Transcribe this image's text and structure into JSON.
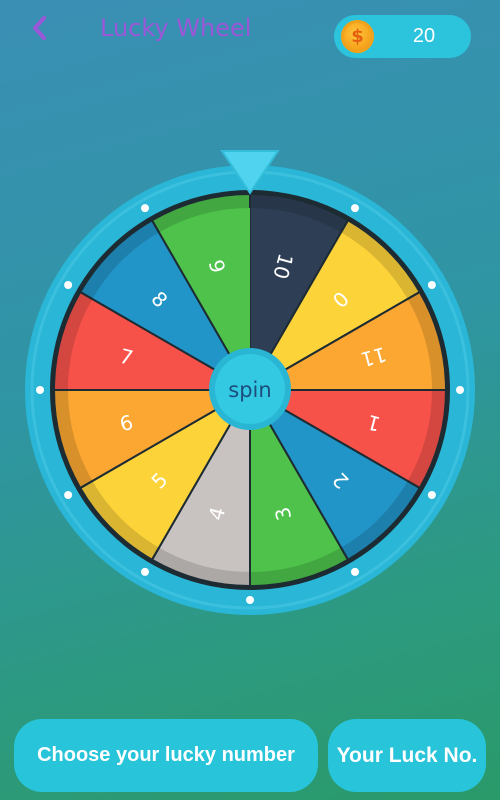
{
  "header": {
    "title": "Lucky Wheel",
    "back_icon": "chevron-left-icon",
    "coins": {
      "icon": "dollar-coin-icon",
      "symbol": "$",
      "count": "20"
    }
  },
  "wheel": {
    "pointer_icon": "triangle-pointer-icon",
    "spin_label": "spin",
    "segments": [
      {
        "label": "10",
        "color": "#2e3f55"
      },
      {
        "label": "0",
        "color": "#fdd33a"
      },
      {
        "label": "11",
        "color": "#fba732"
      },
      {
        "label": "1",
        "color": "#f7524a"
      },
      {
        "label": "2",
        "color": "#2295c8"
      },
      {
        "label": "3",
        "color": "#4ec24b"
      },
      {
        "label": "4",
        "color": "#c8c3c1"
      },
      {
        "label": "5",
        "color": "#fdd33a"
      },
      {
        "label": "6",
        "color": "#fba732"
      },
      {
        "label": "7",
        "color": "#f7524a"
      },
      {
        "label": "8",
        "color": "#2295c8"
      },
      {
        "label": "9",
        "color": "#4ec24b"
      }
    ]
  },
  "buttons": {
    "choose_label": "Choose your lucky number",
    "luck_label": "Your Luck No."
  },
  "colors": {
    "accent": "#27c4da",
    "title": "#9a57d8",
    "rim": "#2ab6d6"
  }
}
